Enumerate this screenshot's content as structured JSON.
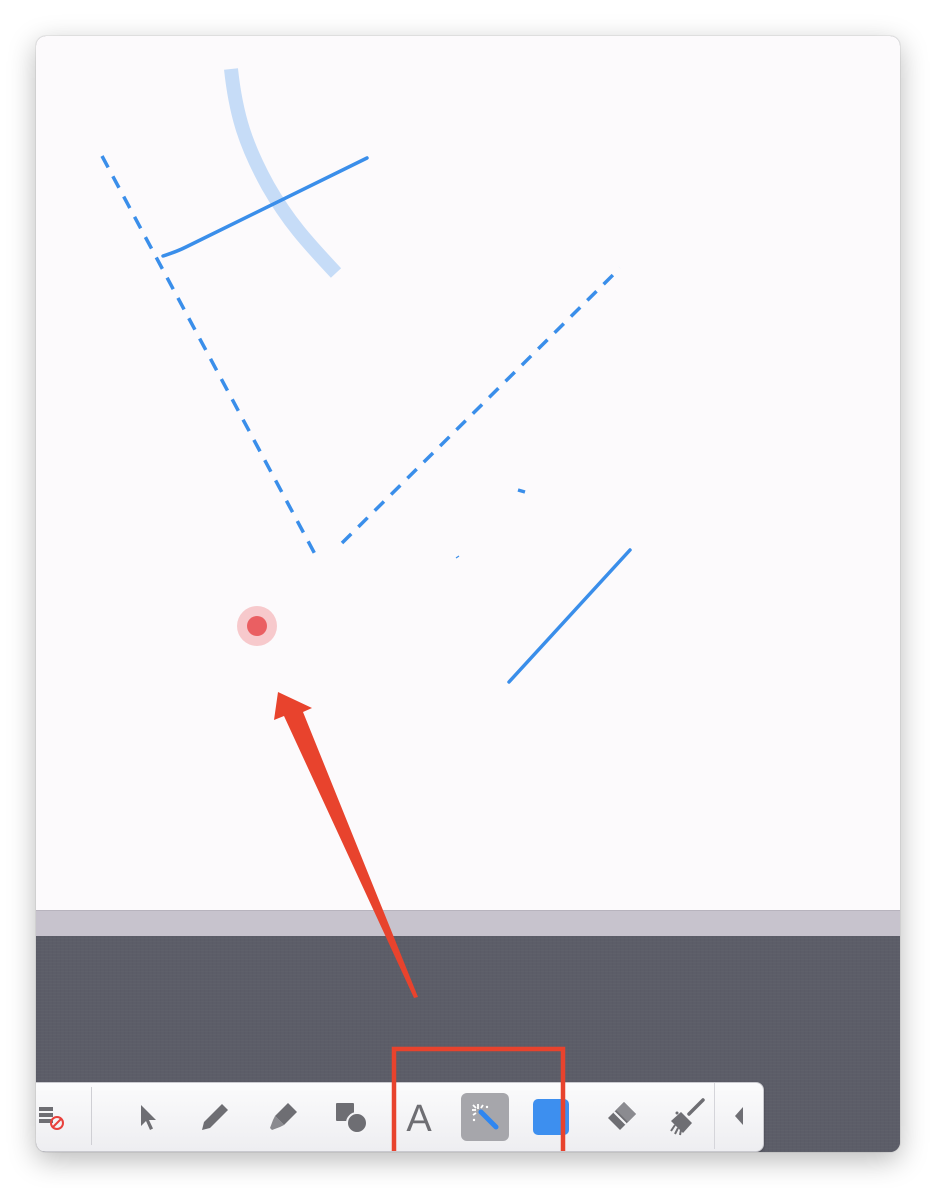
{
  "toolbar": {
    "tools": [
      {
        "id": "clear-page",
        "icon": "page-clear-icon"
      },
      {
        "id": "select",
        "icon": "arrow-pointer-icon"
      },
      {
        "id": "pen",
        "icon": "pen-icon"
      },
      {
        "id": "highlighter",
        "icon": "highlighter-icon"
      },
      {
        "id": "shapes",
        "icon": "shapes-icon"
      },
      {
        "id": "text",
        "icon": "text-icon",
        "label": "A"
      },
      {
        "id": "magic-wand",
        "icon": "magic-wand-icon",
        "active": true
      },
      {
        "id": "color",
        "icon": "color-swatch-icon",
        "color": "#3d8fef"
      },
      {
        "id": "eraser",
        "icon": "eraser-icon"
      },
      {
        "id": "sweep",
        "icon": "broom-icon"
      }
    ],
    "collapse_icon": "triangle-left-icon"
  },
  "colors": {
    "stroke": "#3a8eea",
    "highlight": "#c6dcf7",
    "laser": "#e84c4f",
    "annotation": "#e8432d",
    "canvas": "#fcfafc",
    "workspace": "#5c5d68"
  }
}
